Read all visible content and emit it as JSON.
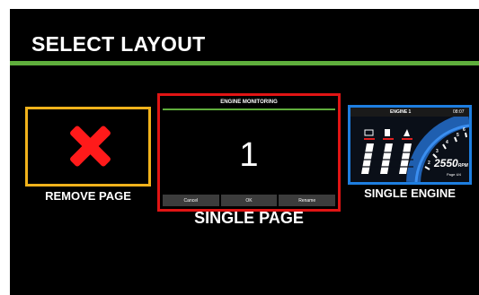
{
  "screen": {
    "title": "SELECT LAYOUT"
  },
  "options": {
    "remove": {
      "label": "REMOVE PAGE"
    },
    "single": {
      "label": "SINGLE PAGE",
      "preview": {
        "title": "ENGINE MONITORING",
        "number": "1",
        "buttons": [
          "Cancel",
          "OK",
          "Rename"
        ]
      }
    },
    "engine": {
      "label": "SINGLE ENGINE",
      "preview": {
        "header_title": "ENGINE 1",
        "header_time": "08:07",
        "rpm_value": "2550",
        "rpm_unit": "RPM",
        "page": "Page 4/4"
      }
    }
  },
  "colors": {
    "accent_green": "#5fae3c",
    "remove_border": "#f0b21b",
    "single_border": "#e01414",
    "engine_border": "#1e7ee0",
    "remove_icon": "#ff1a1a"
  },
  "icons": [
    "red-x-icon",
    "battery-icon",
    "fuel-icon",
    "oil-icon",
    "tachometer-icon"
  ]
}
